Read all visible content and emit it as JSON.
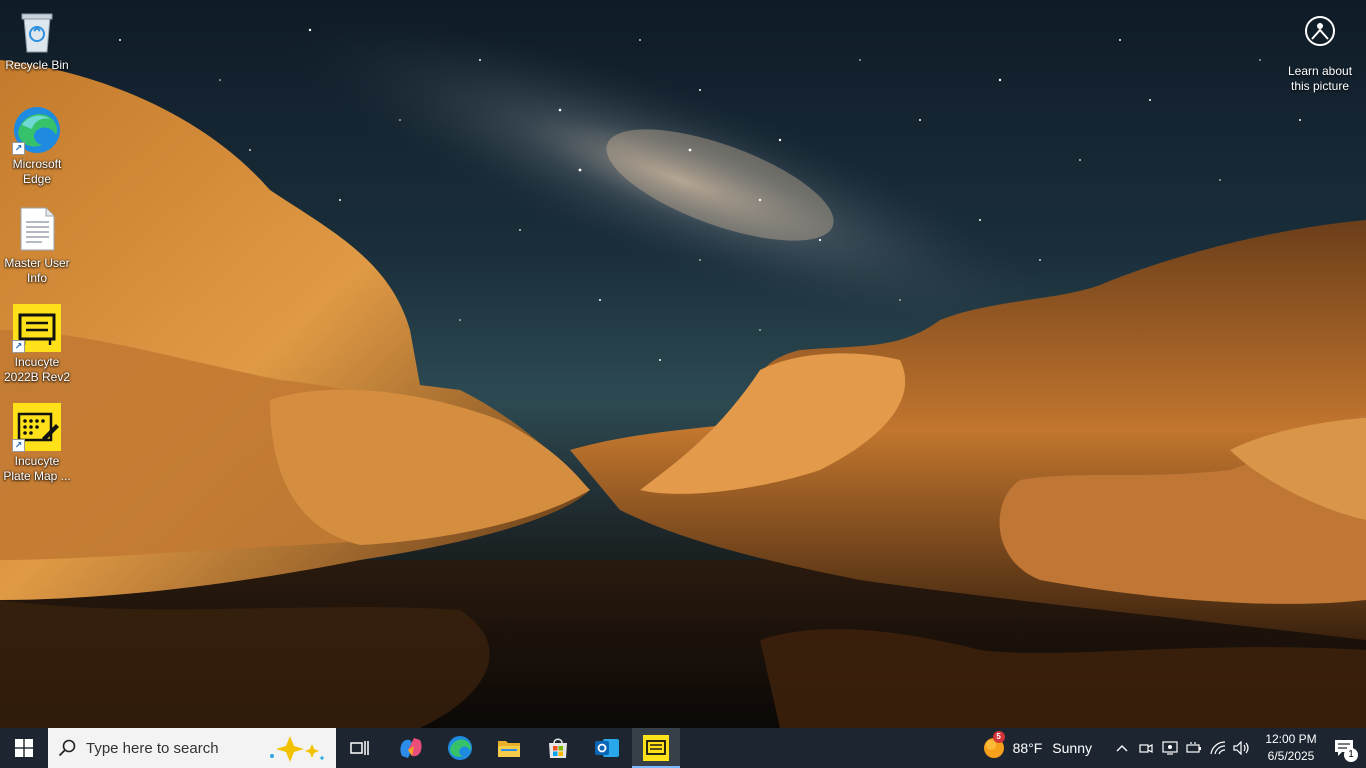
{
  "desktop": {
    "icons": [
      {
        "label": "Recycle Bin"
      },
      {
        "label": "Microsoft Edge"
      },
      {
        "label": "Master User Info"
      },
      {
        "label": "Incucyte 2022B Rev2"
      },
      {
        "label": "Incucyte Plate Map ..."
      }
    ],
    "learn_picture": {
      "label": "Learn about this picture"
    }
  },
  "taskbar": {
    "search": {
      "placeholder": "Type here to search"
    },
    "apps": [
      "start-icon",
      "task-view-icon",
      "copilot-icon",
      "edge-icon",
      "file-explorer-icon",
      "microsoft-store-icon",
      "outlook-icon",
      "incucyte-icon"
    ],
    "weather": {
      "badge": "5",
      "temp": "88°F",
      "condition": "Sunny"
    },
    "clock": {
      "time": "12:00 PM",
      "date": "6/5/2025"
    },
    "notifications": {
      "count": "1"
    }
  },
  "colors": {
    "taskbar_bg": "#1c2530",
    "incucyte_yellow": "#ffe11a",
    "active_underline": "#7ab8ff"
  }
}
